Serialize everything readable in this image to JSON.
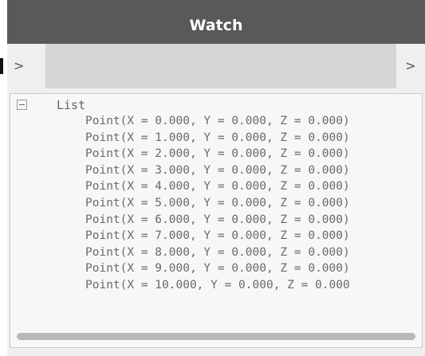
{
  "node": {
    "title": "Watch"
  },
  "ports": {
    "input_label": ">",
    "output_label": ">"
  },
  "watch": {
    "root_label": "List",
    "items": [
      "Point(X = 0.000, Y = 0.000, Z = 0.000)",
      "Point(X = 1.000, Y = 0.000, Z = 0.000)",
      "Point(X = 2.000, Y = 0.000, Z = 0.000)",
      "Point(X = 3.000, Y = 0.000, Z = 0.000)",
      "Point(X = 4.000, Y = 0.000, Z = 0.000)",
      "Point(X = 5.000, Y = 0.000, Z = 0.000)",
      "Point(X = 6.000, Y = 0.000, Z = 0.000)",
      "Point(X = 7.000, Y = 0.000, Z = 0.000)",
      "Point(X = 8.000, Y = 0.000, Z = 0.000)",
      "Point(X = 9.000, Y = 0.000, Z = 0.000)",
      "Point(X = 10.000, Y = 0.000, Z = 0.000"
    ]
  },
  "icons": {
    "collapse": "minus-box-icon"
  },
  "colors": {
    "title_bar": "#595959",
    "node_body": "#efefef",
    "port_row": "#d6d6d6",
    "text": "#6a6a6a"
  }
}
